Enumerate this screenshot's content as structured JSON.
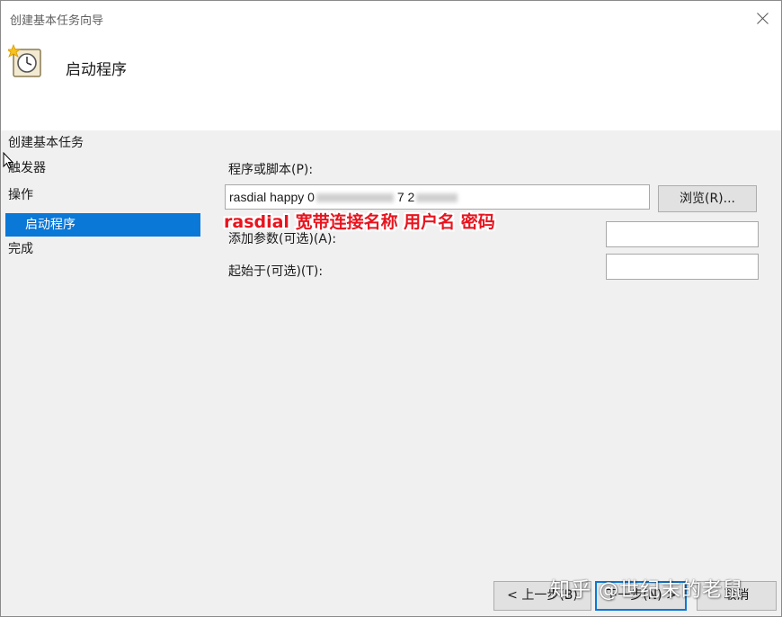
{
  "window": {
    "title": "创建基本任务向导"
  },
  "header": {
    "heading": "启动程序"
  },
  "nav": {
    "section_title": "创建基本任务",
    "items": [
      {
        "label": "触发器",
        "active": false,
        "sub": false
      },
      {
        "label": "操作",
        "active": false,
        "sub": false
      },
      {
        "label": "启动程序",
        "active": true,
        "sub": true
      },
      {
        "label": "完成",
        "active": false,
        "sub": false
      }
    ]
  },
  "form": {
    "program_label": "程序或脚本(P):",
    "program_value": "rasdial happy",
    "program_value_partial_1": "0",
    "program_value_partial_2": "7 2",
    "browse_label": "浏览(R)...",
    "args_label": "添加参数(可选)(A):",
    "args_value": "",
    "start_in_label": "起始于(可选)(T):",
    "start_in_value": ""
  },
  "annotation": {
    "text": "rasdial 宽带连接名称 用户名 密码",
    "color": "#e8141e"
  },
  "footer": {
    "back_label": "< 上一步(B)",
    "next_label": "下一步(N) >",
    "cancel_label": "取消"
  },
  "watermark": {
    "text": "知乎 @世纪末的老鼠"
  },
  "colors": {
    "accent": "#0a78d7",
    "header_bg": "#ffffff",
    "body_bg": "#f0f0f0"
  }
}
